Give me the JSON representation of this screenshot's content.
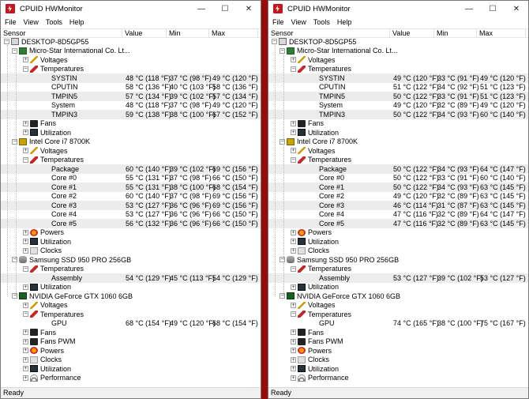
{
  "windows": [
    {
      "title": "CPUID HWMonitor",
      "menu": [
        "File",
        "View",
        "Tools",
        "Help"
      ],
      "columns": [
        "Sensor",
        "Value",
        "Min",
        "Max"
      ],
      "status": "Ready",
      "rows": [
        {
          "label": "DESKTOP-8D5GP55",
          "depth": 0,
          "icon": "computer-icon",
          "exp": "−"
        },
        {
          "label": "Micro-Star International Co. Lt...",
          "depth": 1,
          "icon": "motherboard-icon",
          "exp": "−"
        },
        {
          "label": "Voltages",
          "depth": 2,
          "icon": "voltage-icon",
          "exp": "+"
        },
        {
          "label": "Temperatures",
          "depth": 2,
          "icon": "thermometer-icon",
          "exp": "−"
        },
        {
          "label": "SYSTIN",
          "depth": 3,
          "value": "48 °C  (118 °F)",
          "min": "37 °C  (98 °F)",
          "max": "49 °C  (120 °F)"
        },
        {
          "label": "CPUTIN",
          "depth": 3,
          "value": "58 °C  (136 °F)",
          "min": "40 °C  (103 °F)",
          "max": "58 °C  (136 °F)"
        },
        {
          "label": "TMPIN5",
          "depth": 3,
          "value": "57 °C  (134 °F)",
          "min": "39 °C  (102 °F)",
          "max": "57 °C  (134 °F)"
        },
        {
          "label": "System",
          "depth": 3,
          "value": "48 °C  (118 °F)",
          "min": "37 °C  (98 °F)",
          "max": "49 °C  (120 °F)"
        },
        {
          "label": "TMPIN3",
          "depth": 3,
          "value": "59 °C  (138 °F)",
          "min": "38 °C  (100 °F)",
          "max": "67 °C  (152 °F)"
        },
        {
          "label": "Fans",
          "depth": 2,
          "icon": "fan-icon",
          "exp": "+"
        },
        {
          "label": "Utilization",
          "depth": 2,
          "icon": "utilization-icon",
          "exp": "+"
        },
        {
          "label": "Intel Core i7 8700K",
          "depth": 1,
          "icon": "cpu-icon",
          "exp": "−"
        },
        {
          "label": "Voltages",
          "depth": 2,
          "icon": "voltage-icon",
          "exp": "+"
        },
        {
          "label": "Temperatures",
          "depth": 2,
          "icon": "thermometer-icon",
          "exp": "−"
        },
        {
          "label": "Package",
          "depth": 3,
          "value": "60 °C  (140 °F)",
          "min": "39 °C  (102 °F)",
          "max": "69 °C  (156 °F)"
        },
        {
          "label": "Core #0",
          "depth": 3,
          "value": "55 °C  (131 °F)",
          "min": "37 °C  (98 °F)",
          "max": "66 °C  (150 °F)"
        },
        {
          "label": "Core #1",
          "depth": 3,
          "value": "55 °C  (131 °F)",
          "min": "38 °C  (100 °F)",
          "max": "68 °C  (154 °F)"
        },
        {
          "label": "Core #2",
          "depth": 3,
          "value": "60 °C  (140 °F)",
          "min": "37 °C  (98 °F)",
          "max": "69 °C  (156 °F)"
        },
        {
          "label": "Core #3",
          "depth": 3,
          "value": "53 °C  (127 °F)",
          "min": "36 °C  (96 °F)",
          "max": "69 °C  (156 °F)"
        },
        {
          "label": "Core #4",
          "depth": 3,
          "value": "53 °C  (127 °F)",
          "min": "36 °C  (96 °F)",
          "max": "66 °C  (150 °F)"
        },
        {
          "label": "Core #5",
          "depth": 3,
          "value": "56 °C  (132 °F)",
          "min": "36 °C  (96 °F)",
          "max": "66 °C  (150 °F)"
        },
        {
          "label": "Powers",
          "depth": 2,
          "icon": "power-icon",
          "exp": "+"
        },
        {
          "label": "Utilization",
          "depth": 2,
          "icon": "utilization-icon",
          "exp": "+"
        },
        {
          "label": "Clocks",
          "depth": 2,
          "icon": "clock-icon",
          "exp": "+"
        },
        {
          "label": "Samsung SSD 950 PRO 256GB",
          "depth": 1,
          "icon": "ssd-icon",
          "exp": "−"
        },
        {
          "label": "Temperatures",
          "depth": 2,
          "icon": "thermometer-icon",
          "exp": "−"
        },
        {
          "label": "Assembly",
          "depth": 3,
          "value": "54 °C  (129 °F)",
          "min": "45 °C  (113 °F)",
          "max": "54 °C  (129 °F)"
        },
        {
          "label": "Utilization",
          "depth": 2,
          "icon": "utilization-icon",
          "exp": "+"
        },
        {
          "label": "NVIDIA GeForce GTX 1060 6GB",
          "depth": 1,
          "icon": "gpu-icon",
          "exp": "−"
        },
        {
          "label": "Voltages",
          "depth": 2,
          "icon": "voltage-icon",
          "exp": "+"
        },
        {
          "label": "Temperatures",
          "depth": 2,
          "icon": "thermometer-icon",
          "exp": "−"
        },
        {
          "label": "GPU",
          "depth": 3,
          "value": "68 °C  (154 °F)",
          "min": "49 °C  (120 °F)",
          "max": "68 °C  (154 °F)"
        },
        {
          "label": "Fans",
          "depth": 2,
          "icon": "fan-icon",
          "exp": "+"
        },
        {
          "label": "Fans PWM",
          "depth": 2,
          "icon": "fan-icon",
          "exp": "+"
        },
        {
          "label": "Powers",
          "depth": 2,
          "icon": "power-icon",
          "exp": "+"
        },
        {
          "label": "Clocks",
          "depth": 2,
          "icon": "clock-icon",
          "exp": "+"
        },
        {
          "label": "Utilization",
          "depth": 2,
          "icon": "utilization-icon",
          "exp": "+"
        },
        {
          "label": "Performance",
          "depth": 2,
          "icon": "performance-icon",
          "exp": "+"
        }
      ]
    },
    {
      "title": "CPUID HWMonitor",
      "menu": [
        "File",
        "View",
        "Tools",
        "Help"
      ],
      "columns": [
        "Sensor",
        "Value",
        "Min",
        "Max"
      ],
      "status": "Ready",
      "rows": [
        {
          "label": "DESKTOP-8D5GP55",
          "depth": 0,
          "icon": "computer-icon",
          "exp": "−"
        },
        {
          "label": "Micro-Star International Co. Lt...",
          "depth": 1,
          "icon": "motherboard-icon",
          "exp": "−"
        },
        {
          "label": "Voltages",
          "depth": 2,
          "icon": "voltage-icon",
          "exp": "+"
        },
        {
          "label": "Temperatures",
          "depth": 2,
          "icon": "thermometer-icon",
          "exp": "−"
        },
        {
          "label": "SYSTIN",
          "depth": 3,
          "value": "49 °C  (120 °F)",
          "min": "33 °C  (91 °F)",
          "max": "49 °C  (120 °F)"
        },
        {
          "label": "CPUTIN",
          "depth": 3,
          "value": "51 °C  (122 °F)",
          "min": "34 °C  (92 °F)",
          "max": "51 °C  (123 °F)"
        },
        {
          "label": "TMPIN5",
          "depth": 3,
          "value": "50 °C  (122 °F)",
          "min": "33 °C  (91 °F)",
          "max": "51 °C  (123 °F)"
        },
        {
          "label": "System",
          "depth": 3,
          "value": "49 °C  (120 °F)",
          "min": "32 °C  (89 °F)",
          "max": "49 °C  (120 °F)"
        },
        {
          "label": "TMPIN3",
          "depth": 3,
          "value": "50 °C  (122 °F)",
          "min": "34 °C  (93 °F)",
          "max": "60 °C  (140 °F)"
        },
        {
          "label": "Fans",
          "depth": 2,
          "icon": "fan-icon",
          "exp": "+"
        },
        {
          "label": "Utilization",
          "depth": 2,
          "icon": "utilization-icon",
          "exp": "+"
        },
        {
          "label": "Intel Core i7 8700K",
          "depth": 1,
          "icon": "cpu-icon",
          "exp": "−"
        },
        {
          "label": "Voltages",
          "depth": 2,
          "icon": "voltage-icon",
          "exp": "+"
        },
        {
          "label": "Temperatures",
          "depth": 2,
          "icon": "thermometer-icon",
          "exp": "−"
        },
        {
          "label": "Package",
          "depth": 3,
          "value": "50 °C  (122 °F)",
          "min": "34 °C  (93 °F)",
          "max": "64 °C  (147 °F)"
        },
        {
          "label": "Core #0",
          "depth": 3,
          "value": "50 °C  (122 °F)",
          "min": "33 °C  (91 °F)",
          "max": "60 °C  (140 °F)"
        },
        {
          "label": "Core #1",
          "depth": 3,
          "value": "50 °C  (122 °F)",
          "min": "34 °C  (93 °F)",
          "max": "63 °C  (145 °F)"
        },
        {
          "label": "Core #2",
          "depth": 3,
          "value": "49 °C  (120 °F)",
          "min": "32 °C  (89 °F)",
          "max": "63 °C  (145 °F)"
        },
        {
          "label": "Core #3",
          "depth": 3,
          "value": "46 °C  (114 °F)",
          "min": "31 °C  (87 °F)",
          "max": "63 °C  (145 °F)"
        },
        {
          "label": "Core #4",
          "depth": 3,
          "value": "47 °C  (116 °F)",
          "min": "32 °C  (89 °F)",
          "max": "64 °C  (147 °F)"
        },
        {
          "label": "Core #5",
          "depth": 3,
          "value": "47 °C  (116 °F)",
          "min": "32 °C  (89 °F)",
          "max": "63 °C  (145 °F)"
        },
        {
          "label": "Powers",
          "depth": 2,
          "icon": "power-icon",
          "exp": "+"
        },
        {
          "label": "Utilization",
          "depth": 2,
          "icon": "utilization-icon",
          "exp": "+"
        },
        {
          "label": "Clocks",
          "depth": 2,
          "icon": "clock-icon",
          "exp": "+"
        },
        {
          "label": "Samsung SSD 950 PRO 256GB",
          "depth": 1,
          "icon": "ssd-icon",
          "exp": "−"
        },
        {
          "label": "Temperatures",
          "depth": 2,
          "icon": "thermometer-icon",
          "exp": "−"
        },
        {
          "label": "Assembly",
          "depth": 3,
          "value": "53 °C  (127 °F)",
          "min": "39 °C  (102 °F)",
          "max": "53 °C  (127 °F)"
        },
        {
          "label": "Utilization",
          "depth": 2,
          "icon": "utilization-icon",
          "exp": "+"
        },
        {
          "label": "NVIDIA GeForce GTX 1060 6GB",
          "depth": 1,
          "icon": "gpu-icon",
          "exp": "−"
        },
        {
          "label": "Voltages",
          "depth": 2,
          "icon": "voltage-icon",
          "exp": "+"
        },
        {
          "label": "Temperatures",
          "depth": 2,
          "icon": "thermometer-icon",
          "exp": "−"
        },
        {
          "label": "GPU",
          "depth": 3,
          "value": "74 °C  (165 °F)",
          "min": "38 °C  (100 °F)",
          "max": "75 °C  (167 °F)"
        },
        {
          "label": "Fans",
          "depth": 2,
          "icon": "fan-icon",
          "exp": "+"
        },
        {
          "label": "Fans PWM",
          "depth": 2,
          "icon": "fan-icon",
          "exp": "+"
        },
        {
          "label": "Powers",
          "depth": 2,
          "icon": "power-icon",
          "exp": "+"
        },
        {
          "label": "Clocks",
          "depth": 2,
          "icon": "clock-icon",
          "exp": "+"
        },
        {
          "label": "Utilization",
          "depth": 2,
          "icon": "utilization-icon",
          "exp": "+"
        },
        {
          "label": "Performance",
          "depth": 2,
          "icon": "performance-icon",
          "exp": "+"
        }
      ]
    }
  ]
}
